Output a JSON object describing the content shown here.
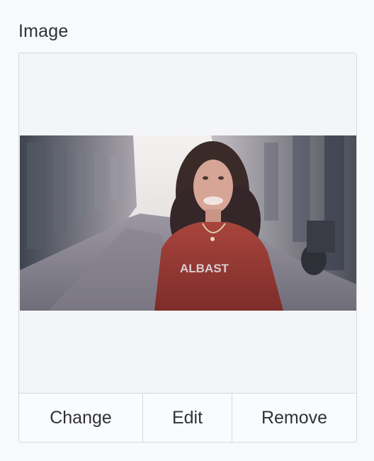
{
  "field": {
    "label": "Image"
  },
  "preview": {
    "alt": "Woman with curly hair in a red sweater standing in a cobblestone street",
    "sweater_text": "ALBAST"
  },
  "actions": {
    "change_label": "Change",
    "edit_label": "Edit",
    "remove_label": "Remove"
  },
  "colors": {
    "border": "#d6d8dc",
    "text": "#303236",
    "background": "#f8f9fb"
  }
}
